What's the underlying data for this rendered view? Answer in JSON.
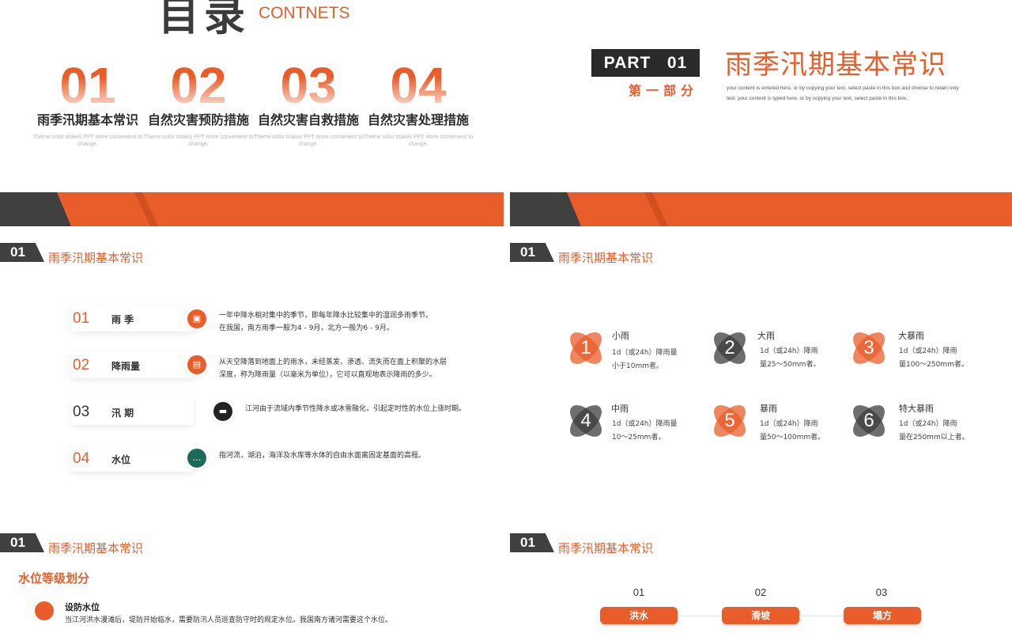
{
  "colors": {
    "accent": "#e85d2a",
    "dark": "#404040",
    "teal": "#1e6a5a",
    "black": "#222222"
  },
  "toc": {
    "title": "目录",
    "subtitle": "CONTNETS",
    "items": [
      {
        "num": "01",
        "label": "雨季汛期基本常识",
        "desc": "Theme color makes PPT more convenient to change."
      },
      {
        "num": "02",
        "label": "自然灾害预防措施",
        "desc": "Theme color makes PPT more convenient to change."
      },
      {
        "num": "03",
        "label": "自然灾害自救措施",
        "desc": "Theme color makes PPT more convenient to change."
      },
      {
        "num": "04",
        "label": "自然灾害处理措施",
        "desc": "Theme color makes PPT more convenient to change."
      }
    ]
  },
  "part": {
    "label": "PART   01",
    "cn": "第一部分",
    "title": "雨季汛期基本常识",
    "desc": "your content is entered here, or by copying your text, select paste in this box and choose to retain only text. your content is typed here, or by copying your text, select paste in this box."
  },
  "section": {
    "num": "01",
    "title": "雨季汛期基本常识"
  },
  "terms": [
    {
      "num": "01",
      "label": "雨 季",
      "icon": "image-icon",
      "glyph": "▣",
      "color": "#e85d2a",
      "text": [
        "一年中降水相对集中的季节，即每年降水比较集中的湿润多雨季节。",
        "在我国，南方雨季一般为4 - 9月，北方一般为6 - 9月。"
      ]
    },
    {
      "num": "02",
      "label": "降雨量",
      "icon": "briefcase-icon",
      "glyph": "▤",
      "color": "#e85d2a",
      "text": [
        "从天空降落到地面上的雨水，未经蒸发、渗透、流失而在面上积聚的水层",
        "深度，称为降雨量（以毫米为单位），它可以直观地表示降雨的多少。"
      ]
    },
    {
      "num": "03",
      "label": "汛 期",
      "icon": "printer-icon",
      "glyph": "▬",
      "color": "#222222",
      "text": [
        "江河由于流域内季节性降水或冰雪融化，引起定时性的水位上涨时期。"
      ]
    },
    {
      "num": "04",
      "label": "水位",
      "icon": "chat-icon",
      "glyph": "…",
      "color": "#1e6a5a",
      "text": [
        "指河流，湖泊，海洋及水库等水体的自由水面离固定基面的高程。"
      ]
    }
  ],
  "rain_levels": [
    {
      "num": "1",
      "name": "小雨",
      "desc": [
        "1d（或24h）降雨量",
        "小于10mm者。"
      ],
      "color": "#e85d2a"
    },
    {
      "num": "2",
      "name": "大雨",
      "desc": [
        "1d（或24h）降雨",
        "量25～50mm者。"
      ],
      "color": "#3d3d3d"
    },
    {
      "num": "3",
      "name": "大暴雨",
      "desc": [
        "1d（或24h）降雨",
        "量100～250mm者。"
      ],
      "color": "#e85d2a"
    },
    {
      "num": "4",
      "name": "中雨",
      "desc": [
        "1d（或24h）降雨量",
        "10～25mm者。"
      ],
      "color": "#3d3d3d"
    },
    {
      "num": "5",
      "name": "暴雨",
      "desc": [
        "1d（或24h）降雨",
        "量50～100mm者。"
      ],
      "color": "#e85d2a"
    },
    {
      "num": "6",
      "name": "特大暴雨",
      "desc": [
        "1d（或24h）降雨",
        "量在250mm以上者。"
      ],
      "color": "#3d3d3d"
    }
  ],
  "water_levels": {
    "heading": "水位等级划分",
    "items": [
      {
        "name": "设防水位",
        "desc": "当江河洪水漫滩后，堤防开始临水，需要防汛人员巡查防守时的规定水位。我国南方诸河需要这个水位。"
      }
    ]
  },
  "disasters": [
    {
      "num": "01",
      "label": "洪水"
    },
    {
      "num": "02",
      "label": "滑坡"
    },
    {
      "num": "03",
      "label": "塌方"
    }
  ]
}
